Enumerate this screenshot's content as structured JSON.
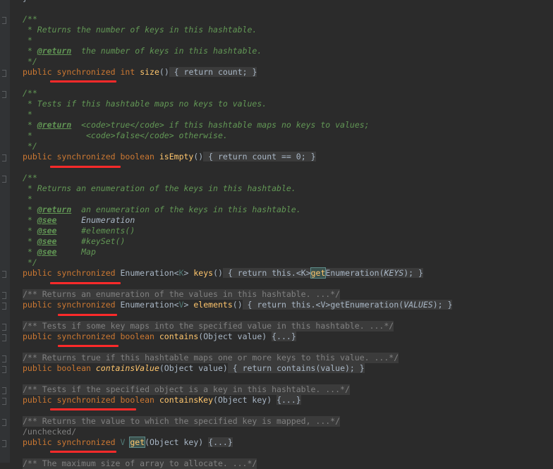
{
  "editor": {
    "lines": [
      {
        "text": "/**",
        "cls": "c"
      },
      {
        "text": " * Returns the number of keys in this hashtable.",
        "cls": "c"
      },
      {
        "text": " *",
        "cls": "c"
      },
      {
        "text": "@return",
        "cls": "tag",
        "pre": " * ",
        "post": "  the number of keys in this hashtable."
      },
      {
        "text": " */",
        "cls": "c"
      },
      {
        "text": "/** Returns an enumeration of the values in this hashtable. ...*/",
        "cls": "fold"
      }
    ],
    "code": {
      "size": "public synchronized int size() { return count; }",
      "isEmpty": "public synchronized boolean isEmpty() { return count == 0; }",
      "keys": "public synchronized Enumeration<K> keys() { return this.<K>getEnumeration(KEYS); }",
      "elements": "public synchronized Enumeration<V> elements() { return this.<V>getEnumeration(VALUES); }",
      "contains": "public synchronized boolean contains(Object value) {...}",
      "containsValue": "public boolean containsValue(Object value) { return contains(value); }",
      "containsKey": "public synchronized boolean containsKey(Object key) {...}",
      "unchecked": "/unchecked/",
      "get": "public synchronized V get(Object key) {...}"
    },
    "comments": {
      "c1": "/**",
      "c1a": " * Returns the number of keys in this hashtable.",
      "c1b": " *",
      "c1c_pre": " * ",
      "c1c_tag": "@return",
      "c1c_post": "  the number of keys in this hashtable.",
      "c1d": " */",
      "c2": "/**",
      "c2a": " * Tests if this hashtable maps no keys to values.",
      "c2b": " *",
      "c2c_tag": "@return",
      "c2c_post": "  <code>true</code> if this hashtable maps no keys to values;",
      "c2d": " *           <code>false</code> otherwise.",
      "c2e": " */",
      "c3": "/**",
      "c3a": " * Returns an enumeration of the keys in this hashtable.",
      "c3b": " *",
      "c3c_tag": "@return",
      "c3c_post": "  an enumeration of the keys in this hashtable.",
      "see1_post": "     Enumeration",
      "see2_post": "     #elements()",
      "see3_post": "     #keySet()",
      "see4_post": "     Map",
      "see_tag": "@see",
      "c3d": " */",
      "f1": "/** Returns an enumeration of the values in this hashtable. ...*/",
      "f2": "/** Tests if some key maps into the specified value in this hashtable. ...*/",
      "f3": "/** Returns true if this hashtable maps one or more keys to this value. ...*/",
      "f4": "/** Tests if the specified object is a key in this hashtable. ...*/",
      "f5": "/** Returns the value to which the specified key is mapped, ...*/",
      "f6": "/** The maximum size of array to allocate. ...*/"
    },
    "colors": {
      "background": "#2b2b2b",
      "keyword": "#cc7832",
      "comment": "#629755",
      "method": "#ffc66d",
      "field": "#9876aa",
      "underline": "#ff2a2a"
    }
  }
}
